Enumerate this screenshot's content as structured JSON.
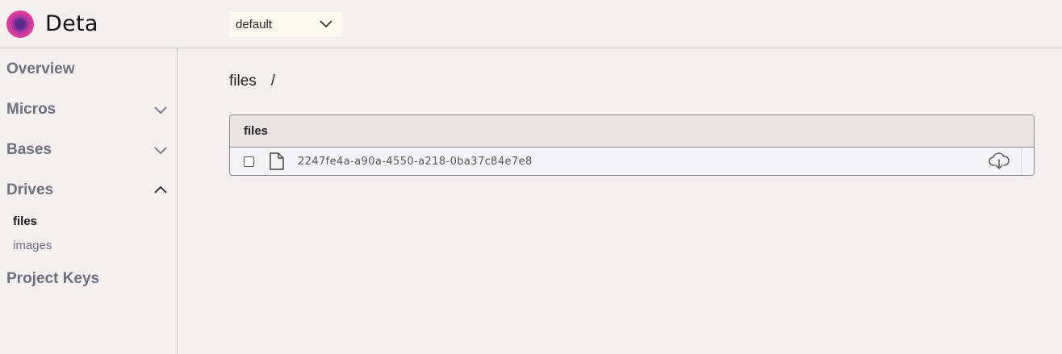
{
  "header": {
    "brand": "Deta",
    "project_select": {
      "value": "default"
    }
  },
  "sidebar": {
    "items": [
      {
        "label": "Overview",
        "expandable": false
      },
      {
        "label": "Micros",
        "expandable": true,
        "expanded": false
      },
      {
        "label": "Bases",
        "expandable": true,
        "expanded": false
      },
      {
        "label": "Drives",
        "expandable": true,
        "expanded": true,
        "children": [
          {
            "label": "files",
            "active": true
          },
          {
            "label": "images",
            "active": false
          }
        ]
      },
      {
        "label": "Project Keys",
        "expandable": false
      }
    ]
  },
  "main": {
    "breadcrumb": {
      "drive": "files",
      "separator": "/"
    },
    "table": {
      "header": "files",
      "rows": [
        {
          "name": "2247fe4a-a90a-4550-a218-0ba37c84e7e8",
          "icon": "file-icon",
          "checked": false
        }
      ]
    }
  },
  "colors": {
    "background": "#f4f0ef",
    "nav_text": "#6e6f7e",
    "select_bg": "#fffaf0",
    "logo_pink": "#ec3d95",
    "logo_purple": "#5b2a8f"
  }
}
